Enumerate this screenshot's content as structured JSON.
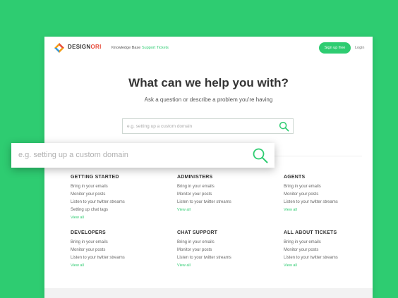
{
  "header": {
    "brand_main": "DESIGN",
    "brand_accent": "ORI",
    "brand_sub": "",
    "nav": [
      "Knowledge Base",
      "Support Tickets"
    ],
    "signup_label": "Sign up free",
    "login_label": "Login"
  },
  "hero": {
    "title": "What can we help you with?",
    "subtitle": "Ask a question or describe a problem you're having"
  },
  "search": {
    "placeholder": "e.g. setting up a custom domain"
  },
  "categories": [
    {
      "title": "GETTING STARTED",
      "links": [
        "Bring in your emails",
        "Monitor your posts",
        "Listen to your twitter streams",
        "Setting up chat tags"
      ],
      "view_all": "View all"
    },
    {
      "title": "ADMINISTERS",
      "links": [
        "Bring in your emails",
        "Monitor your posts",
        "Listen to your twitter streams"
      ],
      "view_all": "View all"
    },
    {
      "title": "AGENTS",
      "links": [
        "Bring in your emails",
        "Monitor your posts",
        "Listen to your twitter streams"
      ],
      "view_all": "View all"
    },
    {
      "title": "DEVELOPERS",
      "links": [
        "Bring in your emails",
        "Monitor your posts",
        "Listen to your twitter streams"
      ],
      "view_all": "View all"
    },
    {
      "title": "CHAT SUPPORT",
      "links": [
        "Bring in your emails",
        "Monitor your posts",
        "Listen to your twitter streams"
      ],
      "view_all": "View all"
    },
    {
      "title": "ALL ABOUT TICKETS",
      "links": [
        "Bring in your emails",
        "Monitor your posts",
        "Listen to your twitter streams"
      ],
      "view_all": "View all"
    }
  ],
  "colors": {
    "background": "#2ecc71",
    "accent": "#2ecc71",
    "text": "#333333"
  },
  "icons": {
    "logo": "diamond-logo-icon",
    "search": "magnifier-icon"
  }
}
